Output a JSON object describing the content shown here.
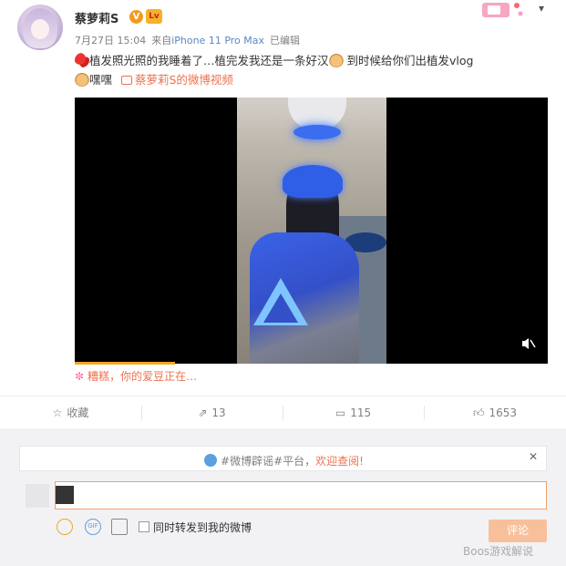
{
  "post": {
    "username": "蔡萝莉S",
    "badge_v": "V",
    "badge_level": "Lv",
    "time": "7月27日 15:04",
    "source_prefix": "来自",
    "source": "iPhone 11 Pro Max",
    "edited": "已编辑",
    "text_line1": "植发照光照的我睡着了…植完发我还是一条好汉",
    "text_line1_tail": "到时候给你们出植发vlog",
    "text_line2_a": "嘿嘿",
    "video_link": "蔡萝莉S的微博视频",
    "caption": "糟糕，你的爱豆正在…"
  },
  "actions": {
    "favorite": "收藏",
    "repost": "13",
    "comment": "115",
    "like": "1653"
  },
  "comment_box": {
    "notice_pre": "#微博辟谣#平台，",
    "notice_hl": "欢迎查阅!",
    "close": "✕",
    "sync_label": "同时转发到我的微博",
    "submit": "评论",
    "gif": "GIF"
  },
  "watermark": "Boos游戏解说",
  "colors": {
    "accent": "#eb7350",
    "link": "#5b88c0",
    "button": "#f8c09a"
  }
}
